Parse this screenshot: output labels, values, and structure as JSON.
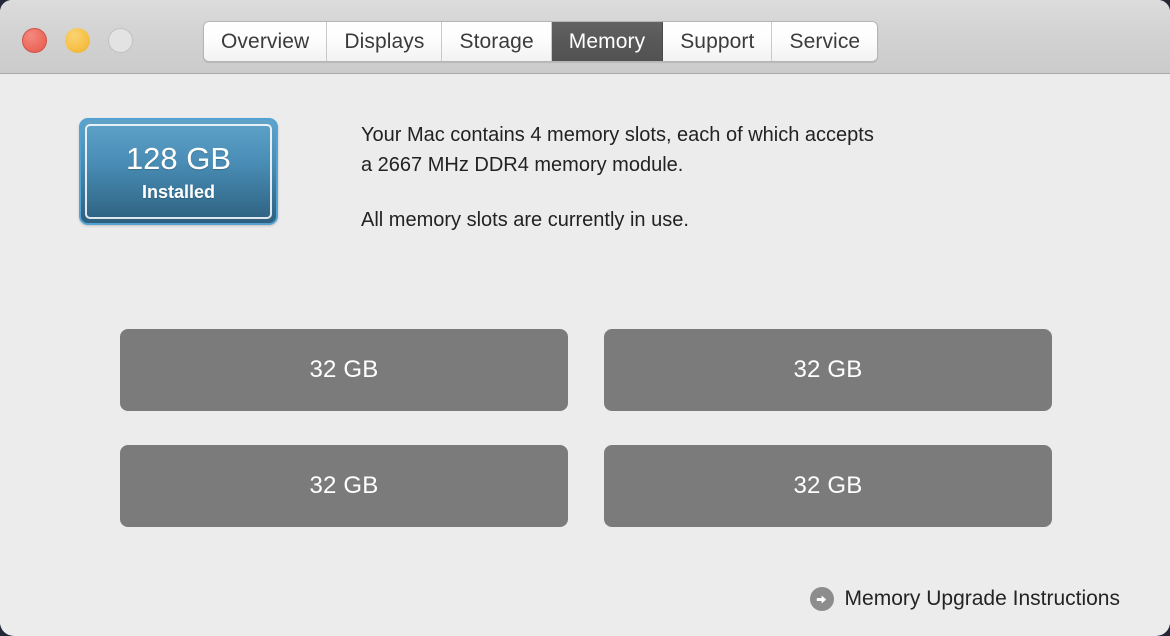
{
  "window": {
    "traffic_lights": [
      {
        "name": "close",
        "color": "#ED6A5E",
        "enabled": true
      },
      {
        "name": "minimize",
        "color": "#F5C045",
        "enabled": true
      },
      {
        "name": "zoom",
        "color": "#E3E3E3",
        "enabled": false
      }
    ]
  },
  "tabs": [
    {
      "label": "Overview",
      "selected": false
    },
    {
      "label": "Displays",
      "selected": false
    },
    {
      "label": "Storage",
      "selected": false
    },
    {
      "label": "Memory",
      "selected": true
    },
    {
      "label": "Support",
      "selected": false
    },
    {
      "label": "Service",
      "selected": false
    }
  ],
  "memory": {
    "installed_total": "128 GB",
    "installed_label": "Installed",
    "badge_accent": "#4b8fb8",
    "description_line_1": "Your Mac contains 4 memory slots, each of which accepts",
    "description_line_2": "a 2667 MHz DDR4 memory module.",
    "status_text": "All memory slots are currently in use.",
    "slots": [
      {
        "capacity": "32 GB"
      },
      {
        "capacity": "32 GB"
      },
      {
        "capacity": "32 GB"
      },
      {
        "capacity": "32 GB"
      }
    ],
    "slot_color": "#7B7B7B"
  },
  "footer": {
    "upgrade_link_label": "Memory Upgrade Instructions",
    "upgrade_link_icon": "arrow-right-circle-icon"
  }
}
